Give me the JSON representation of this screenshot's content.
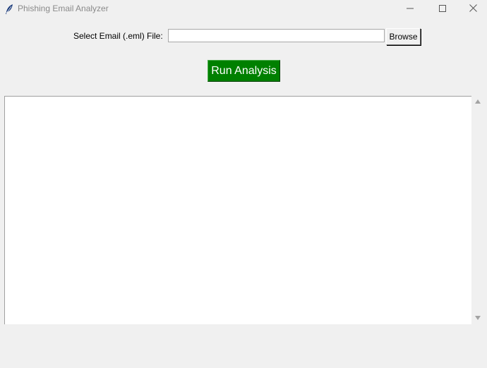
{
  "window": {
    "title": "Phishing Email Analyzer",
    "icon": "feather-icon",
    "controls": [
      "minimize-icon",
      "maximize-icon",
      "close-icon"
    ]
  },
  "file_picker": {
    "label": "Select Email (.eml) File:",
    "value": "",
    "browse_label": "Browse"
  },
  "run_button": {
    "label": "Run Analysis",
    "color": "#008000",
    "text_color": "#ffffff"
  },
  "output": {
    "text": ""
  }
}
